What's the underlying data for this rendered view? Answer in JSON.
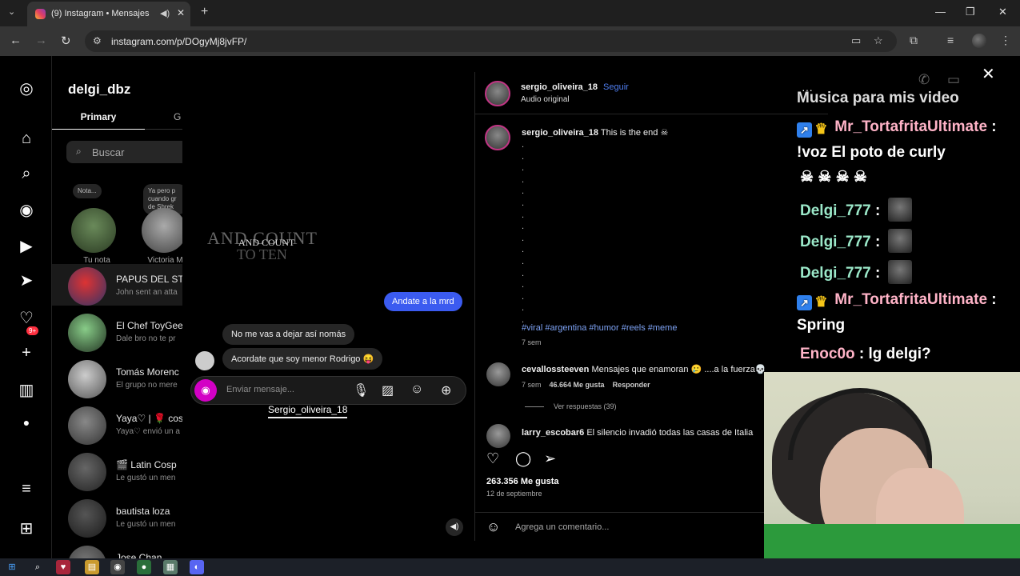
{
  "browser": {
    "tab_title": "(9) Instagram • Mensajes",
    "url": "instagram.com/p/DOgyMj8jvFP/"
  },
  "inbox": {
    "username": "delgi_dbz",
    "tab_primary": "Primary",
    "tab_general": "G",
    "search_placeholder": "Buscar",
    "notes": [
      {
        "bubble": "Nota...",
        "label": "Tu nota"
      },
      {
        "bubble": "Ya pero p cuando gr de Shrek",
        "label": "Victoria Mc"
      }
    ],
    "conversations": [
      {
        "name": "PAPUS DEL STR",
        "preview": "John sent an atta"
      },
      {
        "name": "El Chef ToyGee",
        "preview": "Dale bro no te pr"
      },
      {
        "name": "Tomás Morenc",
        "preview": "El grupo no mere"
      },
      {
        "name": "Yaya♡ | 🌹 cosp",
        "preview": "Yaya♡ envió un a"
      },
      {
        "name": "🎬 Latin Cosp",
        "preview": "Le gustó un men"
      },
      {
        "name": "bautista loza",
        "preview": "Le gustó un men"
      },
      {
        "name": "Jose Chan",
        "preview": ""
      }
    ],
    "unread_badge": "9+"
  },
  "chat": {
    "overlay_top": "AND COUNT",
    "overlay_small": "AND COUNT",
    "overlay_bottom": "TO TEN",
    "overlay_small2": "TO",
    "outgoing_message": "Andate a la mrd",
    "incoming_messages": [
      "No me vas a dejar así nomás",
      "Acordate que soy menor Rodrigo 😝"
    ],
    "composer_placeholder": "Enviar mensaje...",
    "caption": "Sergio_oliveira_18"
  },
  "post": {
    "author": "sergio_oliveira_18",
    "follow": "Seguir",
    "audio": "Audio original",
    "caption_author": "sergio_oliveira_18",
    "caption_text": "This is the end ☠",
    "hashtags": "#viral #argentina #humor #reels #meme",
    "caption_time": "7 sem",
    "comments": [
      {
        "author": "cevallossteeven",
        "text": "Mensajes que enamoran 🥲 ....a la fuerza💀",
        "time": "7 sem",
        "likes": "46.664 Me gusta",
        "reply": "Responder"
      },
      {
        "author": "larry_escobar6",
        "text": "El silencio invadió todas las casas de Italia"
      }
    ],
    "view_replies": "Ver respuestas (39)",
    "like_count": "263.356 Me gusta",
    "date": "12 de septiembre",
    "add_comment_placeholder": "Agrega un comentario..."
  },
  "stream_chat": {
    "top_partial": "Musica para mis video",
    "lines": [
      {
        "user": "Mr_TortafritaUltimate",
        "user_color": "#ffb3c7",
        "text": "!voz El poto de curly"
      },
      {
        "skulls": "☠ ☠ ☠ ☠"
      },
      {
        "user": "Delgi_777",
        "user_color": "#9be8c9"
      },
      {
        "user": "Delgi_777",
        "user_color": "#9be8c9"
      },
      {
        "user": "Delgi_777",
        "user_color": "#9be8c9"
      },
      {
        "user": "Mr_TortafritaUltimate",
        "user_color": "#ffb3c7",
        "text": "Spring"
      },
      {
        "user": "Enoc0o",
        "user_color": "#ffb3c7",
        "text": "lg delgi?"
      }
    ],
    "separator": ":"
  }
}
